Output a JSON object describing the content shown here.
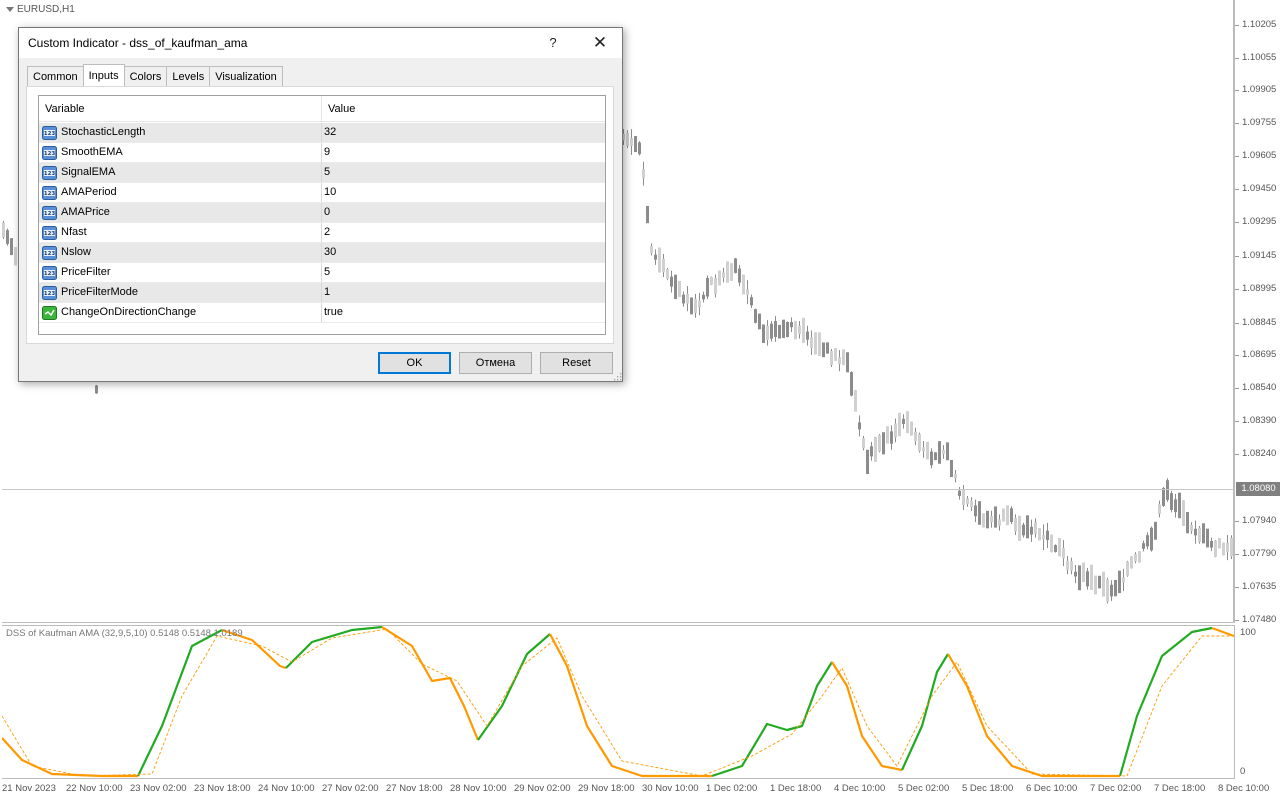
{
  "chart": {
    "symbol": "EURUSD,H1",
    "current_price": "1.08080",
    "price_labels": [
      "1.10205",
      "1.10055",
      "1.09905",
      "1.09755",
      "1.09605",
      "1.09450",
      "1.09295",
      "1.09145",
      "1.08995",
      "1.08845",
      "1.08695",
      "1.08540",
      "1.08390",
      "1.08240",
      "1.07940",
      "1.07790",
      "1.07635",
      "1.07480"
    ],
    "indicator_title": "DSS of Kaufman AMA (32,9,5,10) 0.5148 0.5148 1.0189",
    "indicator_max": "100",
    "indicator_min": "0",
    "time_labels": [
      "21 Nov 2023",
      "22 Nov 10:00",
      "23 Nov 02:00",
      "23 Nov 18:00",
      "24 Nov 10:00",
      "27 Nov 02:00",
      "27 Nov 18:00",
      "28 Nov 10:00",
      "29 Nov 02:00",
      "29 Nov 18:00",
      "30 Nov 10:00",
      "1 Dec 02:00",
      "1 Dec 18:00",
      "4 Dec 10:00",
      "5 Dec 02:00",
      "5 Dec 18:00",
      "6 Dec 10:00",
      "7 Dec 02:00",
      "7 Dec 18:00",
      "8 Dec 10:00"
    ],
    "colors": {
      "up": "#22aa22",
      "down": "#ff9900",
      "candle": "#8c8c8c"
    }
  },
  "dialog": {
    "title": "Custom Indicator - dss_of_kaufman_ama",
    "help": "?",
    "close": "✕",
    "tabs": [
      "Common",
      "Inputs",
      "Colors",
      "Levels",
      "Visualization"
    ],
    "active_tab": "Inputs",
    "headers": {
      "variable": "Variable",
      "value": "Value"
    },
    "params": [
      {
        "name": "StochasticLength",
        "value": "32",
        "icon": "int-icon"
      },
      {
        "name": "SmoothEMA",
        "value": "9",
        "icon": "int-icon"
      },
      {
        "name": "SignalEMA",
        "value": "5",
        "icon": "int-icon"
      },
      {
        "name": "AMAPeriod",
        "value": "10",
        "icon": "int-icon"
      },
      {
        "name": "AMAPrice",
        "value": "0",
        "icon": "int-icon"
      },
      {
        "name": "Nfast",
        "value": "2",
        "icon": "int-icon"
      },
      {
        "name": "Nslow",
        "value": "30",
        "icon": "int-icon"
      },
      {
        "name": "PriceFilter",
        "value": "5",
        "icon": "int-icon"
      },
      {
        "name": "PriceFilterMode",
        "value": "1",
        "icon": "int-icon"
      },
      {
        "name": "ChangeOnDirectionChange",
        "value": "true",
        "icon": "bool-icon"
      }
    ],
    "buttons": {
      "ok": "OK",
      "cancel": "Отмена",
      "reset": "Reset"
    }
  }
}
